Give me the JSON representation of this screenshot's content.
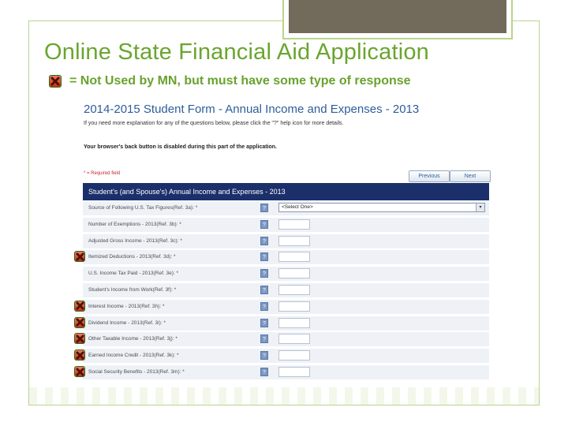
{
  "title": "Online State Financial Aid Application",
  "legend": {
    "icon": "x-mark-icon",
    "text": "= Not Used by MN, but must have some type of response"
  },
  "form": {
    "title": "2014-2015 Student Form - Annual Income and Expenses - 2013",
    "help_text": "If you need more explanation for any of the questions below, please click the \"?\" help icon for more details.",
    "back_notice": "Your browser's back button is disabled during this part of the application.",
    "required_note": "* = Required field",
    "previous_label": "Previous",
    "next_label": "Next",
    "section_header": "Student's (and Spouse's) Annual Income and Expenses - 2013",
    "help_glyph": "?",
    "rows": [
      {
        "label": "Source of Following U.S. Tax Figures(Ref. 3a): *",
        "select": "<Select One>",
        "marked": false
      },
      {
        "label": "Number of Exemptions - 2013(Ref. 3b): *",
        "marked": false
      },
      {
        "label": "Adjusted Gross Income - 2013(Ref. 3c): *",
        "marked": false
      },
      {
        "label": "Itemized Deductions - 2013(Ref. 3d): *",
        "marked": true
      },
      {
        "label": "U.S. Income Tax Paid - 2013(Ref. 3e): *",
        "marked": false
      },
      {
        "label": "Student's Income from Work(Ref. 3f): *",
        "marked": false
      },
      {
        "label": "Interest Income - 2013(Ref. 3h): *",
        "marked": true
      },
      {
        "label": "Dividend Income - 2013(Ref. 3i): *",
        "marked": true
      },
      {
        "label": "Other Taxable Income - 2013(Ref. 3j): *",
        "marked": true
      },
      {
        "label": "Earned Income Credit - 2013(Ref. 3k): *",
        "marked": true
      },
      {
        "label": "Social Security Benefits - 2013(Ref. 3m): *",
        "marked": true
      }
    ]
  },
  "colors": {
    "title": "#6aa52e",
    "form_title": "#2d5e9a",
    "header_bg": "#1b2f6b",
    "row_bg": "#eef2f7",
    "mark_red": "#d6401e"
  }
}
